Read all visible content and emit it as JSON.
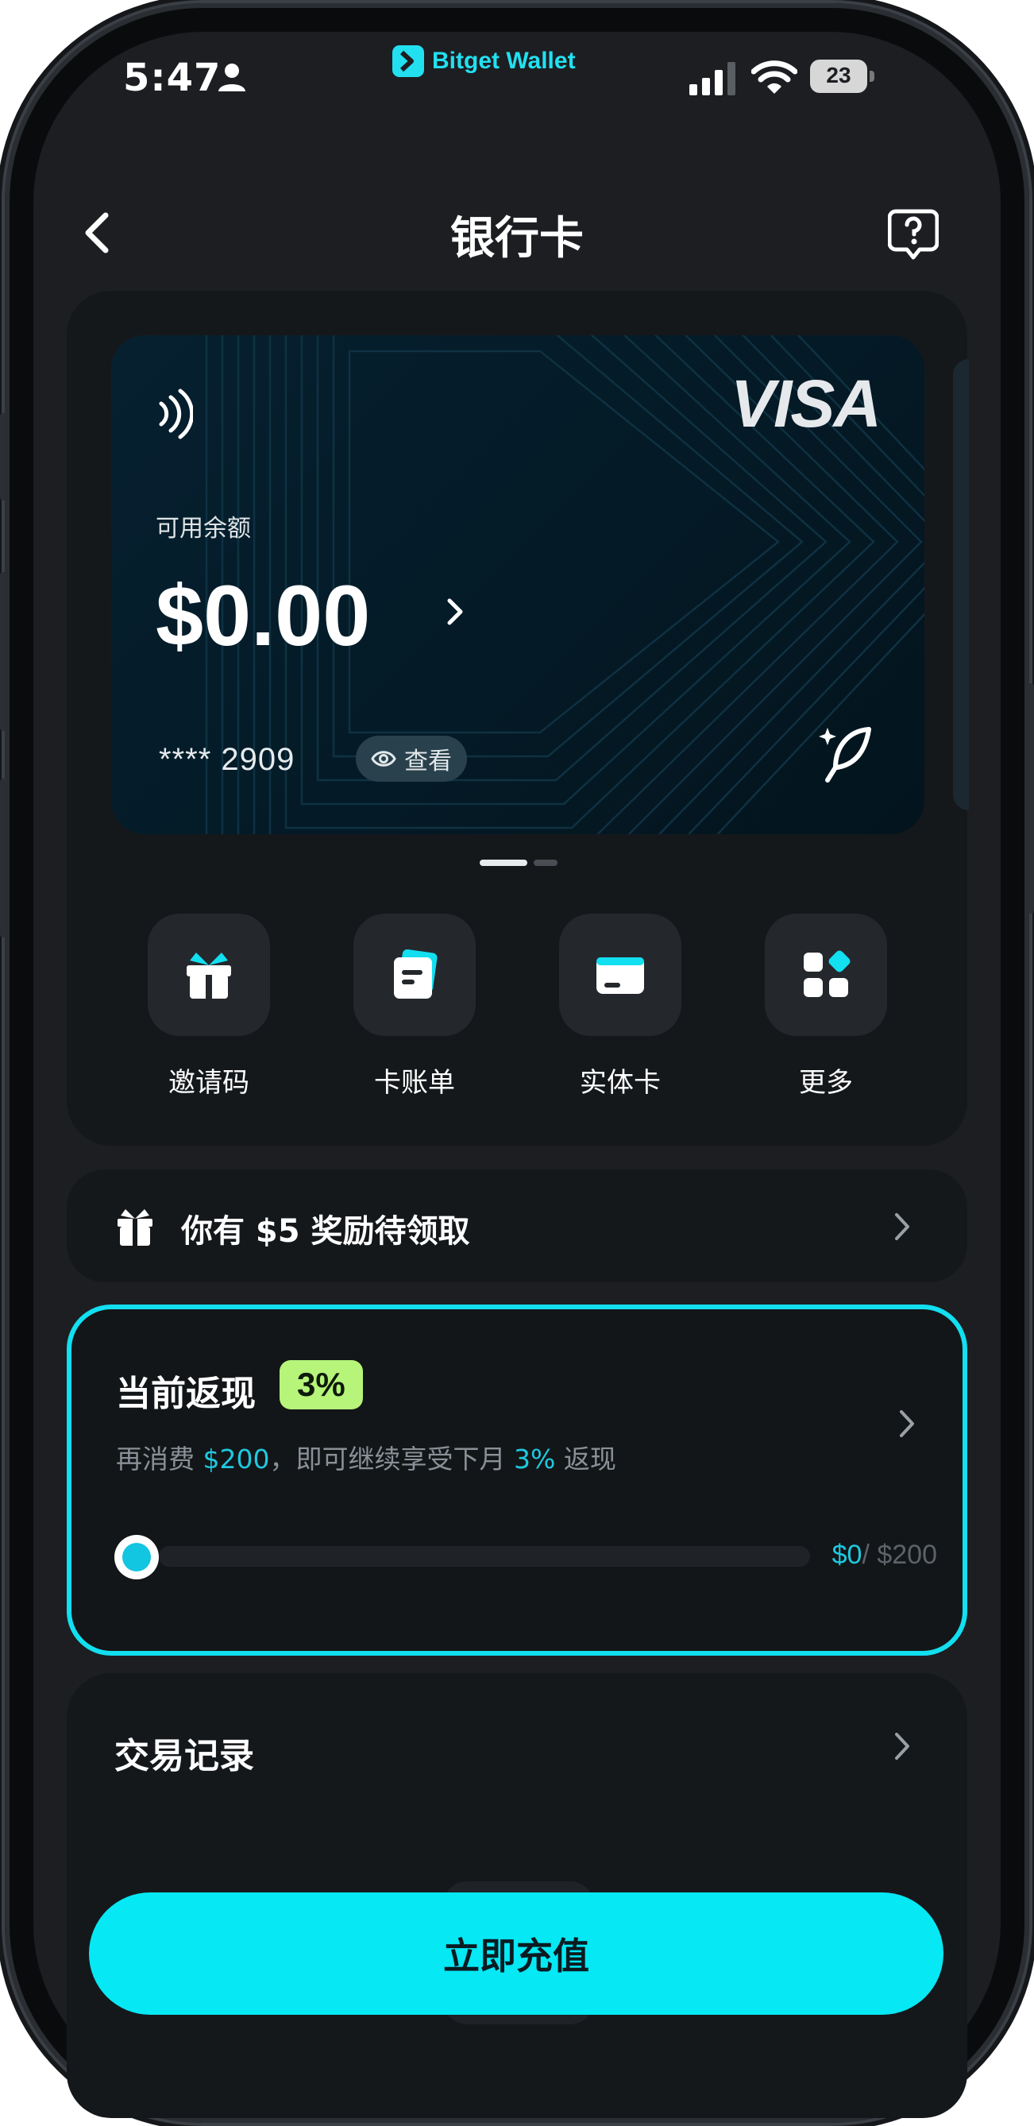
{
  "status_bar": {
    "time": "5:47",
    "brand_name": "Bitget Wallet",
    "battery": "23"
  },
  "header": {
    "title": "银行卡",
    "back_icon": "chevron-left-icon",
    "help_icon": "question-bubble-icon"
  },
  "card": {
    "network": "VISA",
    "balance_label": "可用余额",
    "balance": "$0.00",
    "number_masked": "**** 2909",
    "view_label": "查看",
    "pager": {
      "count": 2,
      "active": 1
    }
  },
  "quick_actions": [
    {
      "label": "邀请码",
      "icon": "gift-icon"
    },
    {
      "label": "卡账单",
      "icon": "bill-icon"
    },
    {
      "label": "实体卡",
      "icon": "card-icon"
    },
    {
      "label": "更多",
      "icon": "grid-icon"
    }
  ],
  "reward": {
    "text": "你有 $5 奖励待领取"
  },
  "cashback": {
    "title": "当前返现",
    "rate": "3%",
    "desc_prefix": "再消费",
    "desc_amount": "$200",
    "desc_middle": "，即可继续享受下月",
    "desc_rate": "3%",
    "desc_suffix": "返现",
    "current": "$0",
    "target": "/ $200",
    "progress": 0.0
  },
  "transactions": {
    "title": "交易记录"
  },
  "cta": {
    "label": "立即充值"
  },
  "colors": {
    "accent": "#06e8f4",
    "badge": "#b6f47a",
    "highlight_text": "#1fc9e0",
    "background": "#1c1e22"
  }
}
